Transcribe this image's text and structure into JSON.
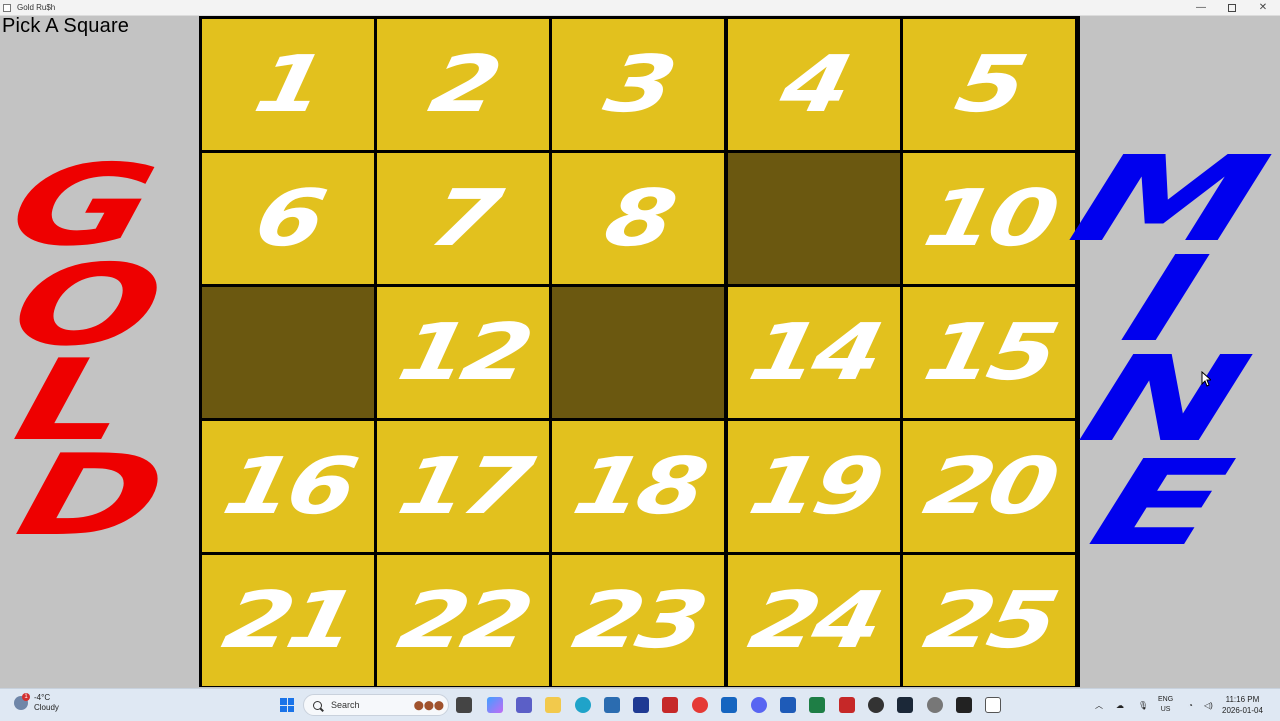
{
  "window": {
    "title": "Gold Ru$h"
  },
  "game": {
    "prompt": "Pick A Square",
    "left_word": [
      "G",
      "O",
      "L",
      "D"
    ],
    "right_word": [
      "M",
      "I",
      "N",
      "E"
    ],
    "colors": {
      "tile": "#e2c11e",
      "taken": "#6b5810",
      "gold_text": "#ee0000",
      "mine_text": "#0000ee"
    },
    "cells": [
      {
        "label": "1",
        "taken": false
      },
      {
        "label": "2",
        "taken": false
      },
      {
        "label": "3",
        "taken": false
      },
      {
        "label": "4",
        "taken": false
      },
      {
        "label": "5",
        "taken": false
      },
      {
        "label": "6",
        "taken": false
      },
      {
        "label": "7",
        "taken": false
      },
      {
        "label": "8",
        "taken": false
      },
      {
        "label": "",
        "taken": true
      },
      {
        "label": "10",
        "taken": false
      },
      {
        "label": "",
        "taken": true
      },
      {
        "label": "12",
        "taken": false
      },
      {
        "label": "",
        "taken": true
      },
      {
        "label": "14",
        "taken": false
      },
      {
        "label": "15",
        "taken": false
      },
      {
        "label": "16",
        "taken": false
      },
      {
        "label": "17",
        "taken": false
      },
      {
        "label": "18",
        "taken": false
      },
      {
        "label": "19",
        "taken": false
      },
      {
        "label": "20",
        "taken": false
      },
      {
        "label": "21",
        "taken": false
      },
      {
        "label": "22",
        "taken": false
      },
      {
        "label": "23",
        "taken": false
      },
      {
        "label": "24",
        "taken": false
      },
      {
        "label": "25",
        "taken": false
      }
    ]
  },
  "taskbar": {
    "weather_temp": "-4°C",
    "weather_desc": "Cloudy",
    "weather_badge": "1",
    "search_label": "Search",
    "lang_1": "ENG",
    "lang_2": "US",
    "time": "11:16 PM",
    "date": "2026-01-04"
  }
}
